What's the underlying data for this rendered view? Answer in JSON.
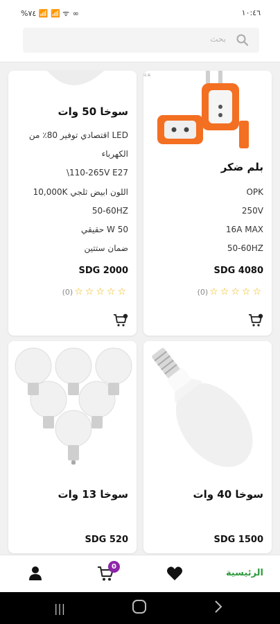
{
  "status_bar": {
    "left_text": "%٧٤ 📶 📶 ᯤ ∞",
    "right_text": "١٠:٤٦"
  },
  "search": {
    "placeholder": "بحث"
  },
  "products": [
    {
      "title": "بلم ضكر",
      "specs": [
        "OPK",
        "250V",
        "16A MAX",
        "50-60HZ"
      ],
      "price": "SDG 4080",
      "rating_count": "(0)"
    },
    {
      "title": "سوخا 50 وات",
      "specs": [
        "LED اقتصادي توفير 80٪ من",
        "الكهرباء",
        "110-265V  E27\\",
        "اللون ابيض ثلجي 10,000K",
        "50-60HZ",
        "50 W حقيقي",
        "ضمان ستتين"
      ],
      "price": "SDG 2000",
      "rating_count": "(0)"
    },
    {
      "title": "سوخا 40 وات",
      "specs": [],
      "price": "SDG 1500",
      "rating_count": ""
    },
    {
      "title": "سوخا 13 وات",
      "specs": [],
      "price": "SDG 520",
      "rating_count": ""
    }
  ],
  "bottom_nav": {
    "home_label": "الرئيسية",
    "cart_badge": "0"
  },
  "colors": {
    "accent_green": "#2e9c3d",
    "badge_purple": "#8e24aa",
    "star_gold": "#f0b400"
  }
}
